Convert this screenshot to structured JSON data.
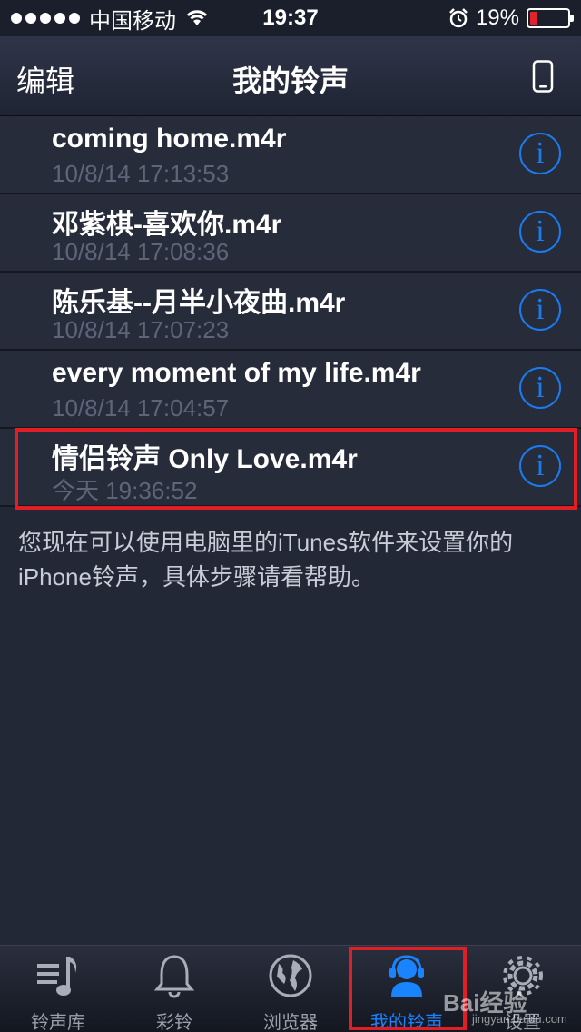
{
  "status_bar": {
    "carrier": "中国移动",
    "time": "19:37",
    "battery": "19%",
    "battery_level": 0.19
  },
  "nav": {
    "edit_label": "编辑",
    "title": "我的铃声"
  },
  "ringtones": [
    {
      "name": "coming home.m4r",
      "date": "10/8/14 17:13:53"
    },
    {
      "name": "邓紫棋-喜欢你.m4r",
      "date": "10/8/14 17:08:36"
    },
    {
      "name": "陈乐基--月半小夜曲.m4r",
      "date": "10/8/14 17:07:23"
    },
    {
      "name": "every moment of my life.m4r",
      "date": "10/8/14 17:04:57"
    },
    {
      "name": "情侣铃声 Only Love.m4r",
      "date": "今天 19:36:52"
    }
  ],
  "info_glyph": "i",
  "help_text": "您现在可以使用电脑里的iTunes软件来设置你的iPhone铃声，具体步骤请看帮助。",
  "tabs": [
    {
      "label": "铃声库",
      "icon": "music-note-icon"
    },
    {
      "label": "彩铃",
      "icon": "bell-icon"
    },
    {
      "label": "浏览器",
      "icon": "globe-icon"
    },
    {
      "label": "我的铃声",
      "icon": "headphones-user-icon",
      "active": true
    },
    {
      "label": "设置",
      "icon": "gear-icon"
    }
  ],
  "watermark": {
    "brand": "Bai经验",
    "url": "jingyan.baidu.com"
  },
  "colors": {
    "accent": "#1a7cf0",
    "highlight": "#e01e26",
    "background": "#232836"
  }
}
